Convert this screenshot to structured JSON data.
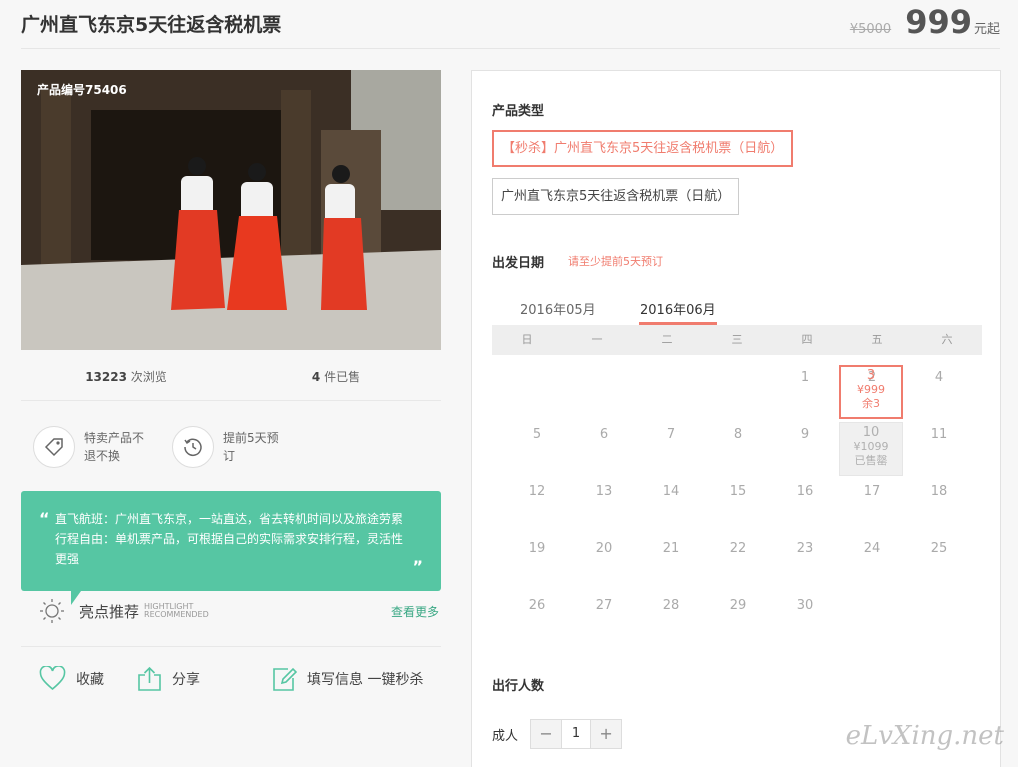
{
  "title": "广州直飞东京5天往返含税机票",
  "price": {
    "original": "¥5000",
    "current": "999",
    "unit": "元起"
  },
  "product_no": "产品编号75406",
  "stats": {
    "views_num": "13223",
    "views_label": " 次浏览",
    "sold_num": "4",
    "sold_label": " 件已售"
  },
  "features": [
    {
      "icon": "tag-icon",
      "text": "特卖产品不退不换"
    },
    {
      "icon": "clock-icon",
      "text": "提前5天预订"
    }
  ],
  "quote": "直飞航班：广州直飞东京，一站直达，省去转机时间以及旅途劳累行程自由：单机票产品，可根据自己的实际需求安排行程，灵活性更强",
  "highlight": {
    "title": "亮点推荐",
    "en1": "HIGHTLIGHT",
    "en2": "RECOMMENDED",
    "more": "查看更多"
  },
  "actions": {
    "fav": "收藏",
    "share": "分享",
    "fill": "填写信息 一键秒杀"
  },
  "panel": {
    "type_label": "产品类型",
    "types": [
      "【秒杀】广州直飞东京5天往返含税机票（日航）",
      "广州直飞东京5天往返含税机票（日航）"
    ],
    "date_label": "出发日期",
    "date_note": "请至少提前5天预订",
    "months": [
      "2016年05月",
      "2016年06月"
    ],
    "weekdays": [
      "日",
      "一",
      "二",
      "三",
      "四",
      "五",
      "六"
    ],
    "hot_day": {
      "day": "3",
      "price": "¥999",
      "left": "余3"
    },
    "sold_day": {
      "day": "10",
      "price": "¥1099",
      "status": "已售罄"
    },
    "pax_label": "出行人数",
    "adult": "成人",
    "minus": "−",
    "qty": "1",
    "plus": "+"
  },
  "watermark": "eLvXing.net",
  "colors": {
    "accent": "#f07c6e",
    "green": "#56c6a3"
  }
}
